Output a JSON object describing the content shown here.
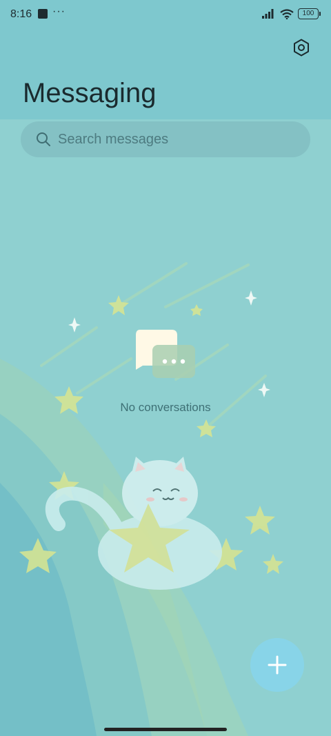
{
  "status_bar": {
    "time": "8:16",
    "more": "···",
    "battery": "100"
  },
  "header": {
    "title": "Messaging",
    "settings_icon": "settings-icon"
  },
  "search": {
    "placeholder": "Search messages",
    "value": ""
  },
  "empty_state": {
    "text": "No conversations",
    "icon": "chat-bubbles-icon"
  },
  "fab": {
    "icon": "plus-icon"
  },
  "colors": {
    "header": "#7ec8ce",
    "background": "#8fd0d0",
    "fab": "#88d4e8",
    "title": "#1a2a2e"
  }
}
